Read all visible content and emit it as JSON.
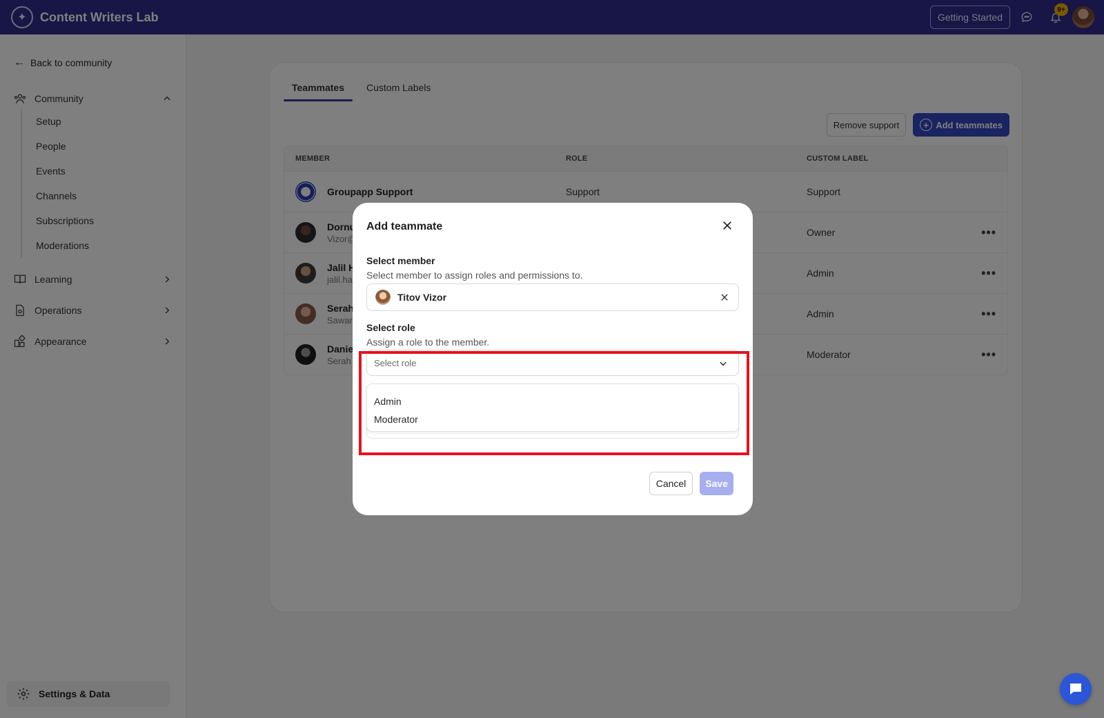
{
  "app": {
    "name": "Content Writers Lab"
  },
  "topbar": {
    "getting_started": "Getting Started",
    "notifications_badge": "9+"
  },
  "sidebar": {
    "back_link": "Back to community",
    "community": {
      "label": "Community",
      "items": [
        "Setup",
        "People",
        "Events",
        "Channels",
        "Subscriptions",
        "Moderations"
      ]
    },
    "learning": "Learning",
    "operations": "Operations",
    "appearance": "Appearance",
    "settings": "Settings & Data"
  },
  "main": {
    "tabs": [
      "Teammates",
      "Custom Labels"
    ],
    "remove_support": "Remove support",
    "add_teammates": "Add teammates",
    "columns": {
      "member": "MEMBER",
      "role": "ROLE",
      "custom_label": "CUSTOM LABEL"
    },
    "rows": [
      {
        "name": "Groupapp Support",
        "email": "",
        "role": "Support",
        "label": "Support"
      },
      {
        "name": "Dornu",
        "email": "Vizor@",
        "role": "",
        "label": "Owner"
      },
      {
        "name": "Jalil H",
        "email": "jalil.ha",
        "role": "",
        "label": "Admin"
      },
      {
        "name": "Serah",
        "email": "Sawar",
        "role": "",
        "label": "Admin"
      },
      {
        "name": "Daniel",
        "email": "Serah",
        "role": "",
        "label": "Moderator"
      }
    ]
  },
  "modal": {
    "title": "Add teammate",
    "member_label": "Select member",
    "member_help": "Select member to assign roles and permissions to.",
    "member_value": "Titov Vizor",
    "role_label": "Select role",
    "role_help": "Assign a role to the member.",
    "role_placeholder": "Select role",
    "role_options": [
      "Admin",
      "Moderator"
    ],
    "cancel": "Cancel",
    "save": "Save"
  },
  "colors": {
    "topbar": "#2e2d8f",
    "primary": "#3448c5",
    "highlight": "#e5131d",
    "save_disabled": "#a6aef0"
  }
}
